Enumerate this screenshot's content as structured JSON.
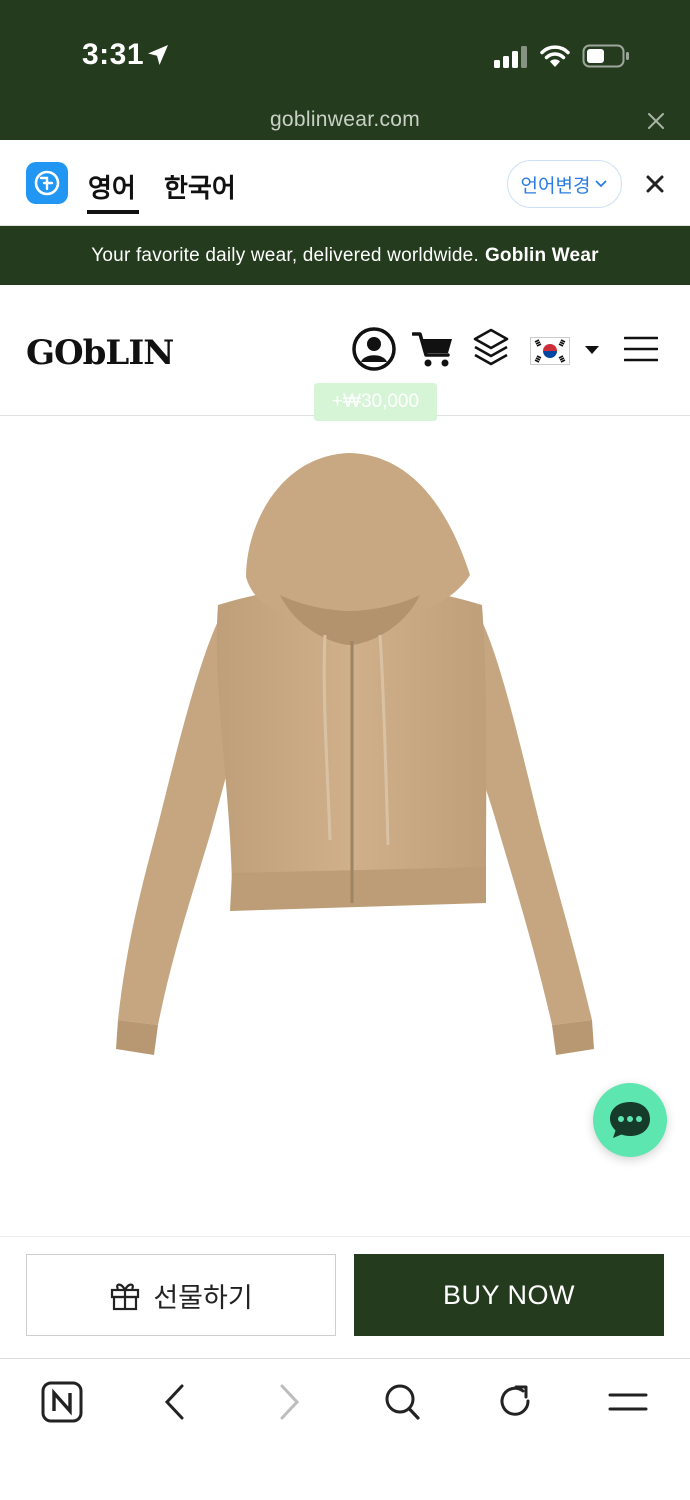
{
  "status_bar": {
    "time": "3:31"
  },
  "url_bar": {
    "domain": "goblinwear.com"
  },
  "translate_bar": {
    "tab_english": "영어",
    "tab_korean": "한국어",
    "change_language": "언어변경"
  },
  "announcement": {
    "text": "Your favorite daily wear, delivered worldwide.",
    "brand": "Goblin Wear"
  },
  "header": {
    "logo": "GObLIN",
    "points_badge": "+₩30,000"
  },
  "actions": {
    "gift_label": "선물하기",
    "buy_label": "BUY NOW"
  },
  "colors": {
    "brand_green": "#243b1e",
    "product_beige": "#c9a983",
    "chat_green": "#5de6b0",
    "translate_blue": "#2196f3"
  },
  "icons": [
    "location-arrow-icon",
    "signal-icon",
    "wifi-icon",
    "battery-icon",
    "close-icon",
    "user-icon",
    "cart-icon",
    "layers-icon",
    "korea-flag-icon",
    "dropdown-caret-icon",
    "menu-icon",
    "chat-icon",
    "gift-icon",
    "naver-icon",
    "back-icon",
    "forward-icon",
    "search-icon",
    "reload-icon"
  ]
}
